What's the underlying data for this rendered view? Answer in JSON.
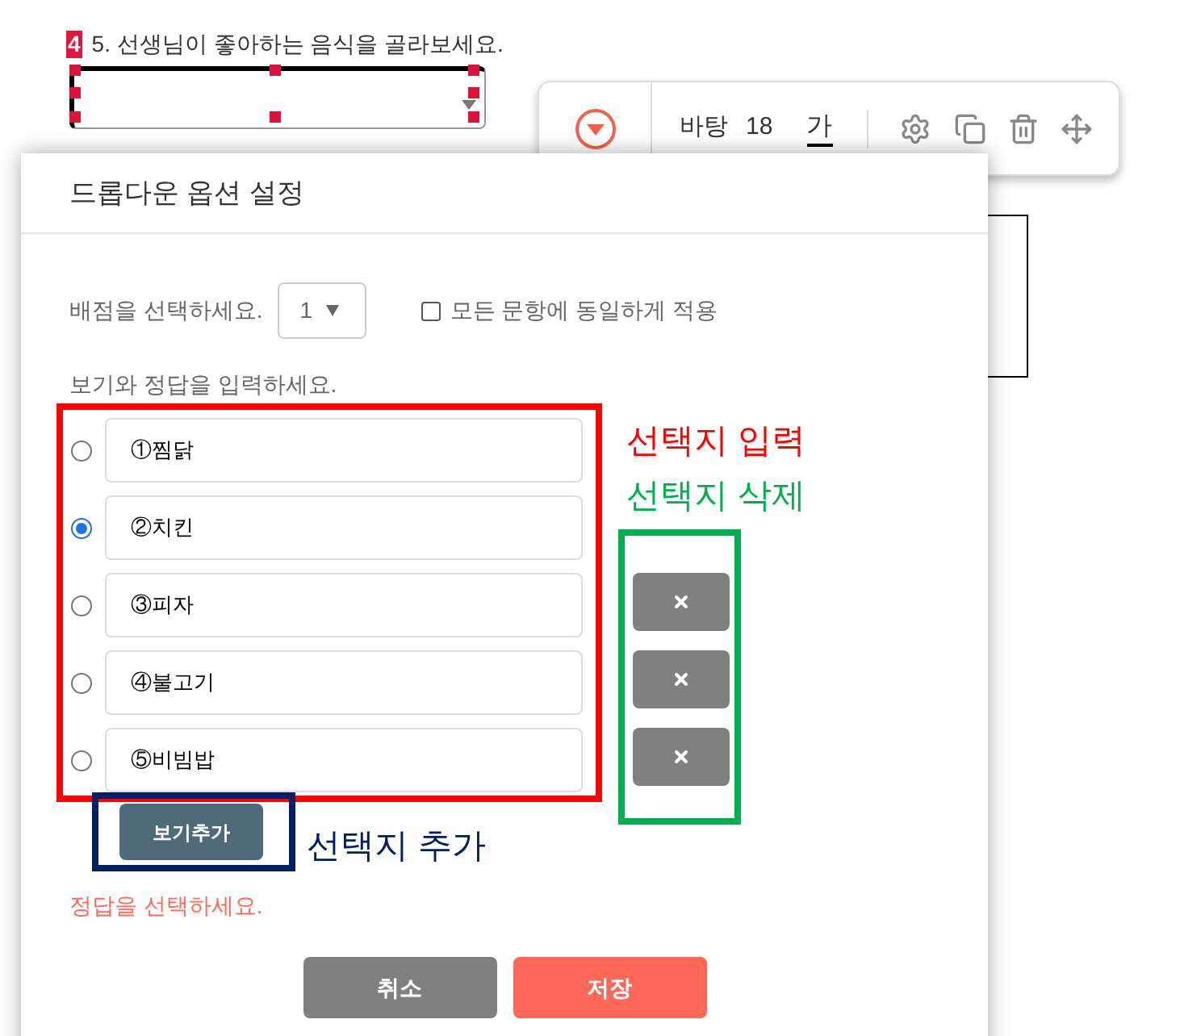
{
  "question": {
    "badge": "4",
    "text": "5. 선생님이 좋아하는 음식을 골라보세요."
  },
  "toolbar": {
    "font": "바탕",
    "size": "18",
    "sample": "가"
  },
  "dialog": {
    "title": "드롭다운 옵션 설정",
    "score_label": "배점을 선택하세요.",
    "score_value": "1",
    "apply_all": {
      "label": "모든 문항에 동일하게 적용",
      "checked": false
    },
    "options_label": "보기와 정답을 입력하세요.",
    "options": [
      {
        "text": "①찜닭",
        "selected": false,
        "deletable": false
      },
      {
        "text": "②치킨",
        "selected": true,
        "deletable": false
      },
      {
        "text": "③피자",
        "selected": false,
        "deletable": true
      },
      {
        "text": "④불고기",
        "selected": false,
        "deletable": true
      },
      {
        "text": "⑤비빔밥",
        "selected": false,
        "deletable": true
      }
    ],
    "add_button": "보기추가",
    "error": "정답을 선택하세요.",
    "buttons": [
      {
        "label": "취소",
        "kind": "cancel"
      },
      {
        "label": "저장",
        "kind": "save"
      }
    ]
  },
  "annotations": [
    {
      "text": "선택지 입력",
      "color": "#ff0000"
    },
    {
      "text": "선택지 삭제",
      "color": "#00b050"
    },
    {
      "text": "선택지 추가",
      "color": "#002060"
    }
  ]
}
